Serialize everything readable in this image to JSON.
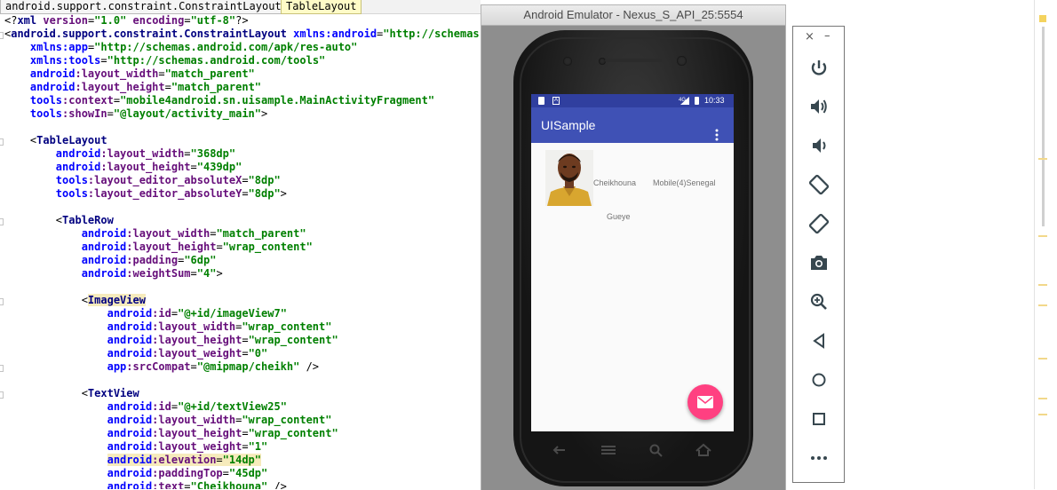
{
  "breadcrumb": [
    "android.support.constraint.ConstraintLayout",
    "TableLayout"
  ],
  "code_lines": [
    [
      [
        "t",
        "<?"
      ],
      [
        "tag",
        "xml "
      ],
      [
        "attr",
        "version"
      ],
      [
        "t",
        "="
      ],
      [
        "val",
        "\"1.0\""
      ],
      [
        "t",
        " "
      ],
      [
        "attr",
        "encoding"
      ],
      [
        "t",
        "="
      ],
      [
        "val",
        "\"utf-8\""
      ],
      [
        "t",
        "?>"
      ]
    ],
    [
      [
        "t",
        "<"
      ],
      [
        "tag",
        "android.support.constraint.ConstraintLayout "
      ],
      [
        "ns",
        "xmlns:android"
      ],
      [
        "t",
        "="
      ],
      [
        "val",
        "\"http://schemas.an"
      ]
    ],
    [
      [
        "t",
        "    "
      ],
      [
        "ns",
        "xmlns:app"
      ],
      [
        "t",
        "="
      ],
      [
        "val",
        "\"http://schemas.android.com/apk/res-auto\""
      ]
    ],
    [
      [
        "t",
        "    "
      ],
      [
        "ns",
        "xmlns:tools"
      ],
      [
        "t",
        "="
      ],
      [
        "val",
        "\"http://schemas.android.com/tools\""
      ]
    ],
    [
      [
        "t",
        "    "
      ],
      [
        "ns",
        "android"
      ],
      [
        "attr",
        ":layout_width"
      ],
      [
        "t",
        "="
      ],
      [
        "val",
        "\"match_parent\""
      ]
    ],
    [
      [
        "t",
        "    "
      ],
      [
        "ns",
        "android"
      ],
      [
        "attr",
        ":layout_height"
      ],
      [
        "t",
        "="
      ],
      [
        "val",
        "\"match_parent\""
      ]
    ],
    [
      [
        "t",
        "    "
      ],
      [
        "ns",
        "tools"
      ],
      [
        "attr",
        ":context"
      ],
      [
        "t",
        "="
      ],
      [
        "val",
        "\"mobile4android.sn.uisample.MainActivityFragment\""
      ]
    ],
    [
      [
        "t",
        "    "
      ],
      [
        "ns",
        "tools"
      ],
      [
        "attr",
        ":showIn"
      ],
      [
        "t",
        "="
      ],
      [
        "val",
        "\"@layout/activity_main\""
      ],
      [
        "t",
        ">"
      ]
    ],
    [],
    [
      [
        "t",
        "    <"
      ],
      [
        "tag",
        "TableLayout"
      ]
    ],
    [
      [
        "t",
        "        "
      ],
      [
        "ns",
        "android"
      ],
      [
        "attr",
        ":layout_width"
      ],
      [
        "t",
        "="
      ],
      [
        "val",
        "\"368dp\""
      ]
    ],
    [
      [
        "t",
        "        "
      ],
      [
        "ns",
        "android"
      ],
      [
        "attr",
        ":layout_height"
      ],
      [
        "t",
        "="
      ],
      [
        "val",
        "\"439dp\""
      ]
    ],
    [
      [
        "t",
        "        "
      ],
      [
        "ns",
        "tools"
      ],
      [
        "attr",
        ":layout_editor_absoluteX"
      ],
      [
        "t",
        "="
      ],
      [
        "val",
        "\"8dp\""
      ]
    ],
    [
      [
        "t",
        "        "
      ],
      [
        "ns",
        "tools"
      ],
      [
        "attr",
        ":layout_editor_absoluteY"
      ],
      [
        "t",
        "="
      ],
      [
        "val",
        "\"8dp\""
      ],
      [
        "t",
        ">"
      ]
    ],
    [],
    [
      [
        "t",
        "        <"
      ],
      [
        "tag",
        "TableRow"
      ]
    ],
    [
      [
        "t",
        "            "
      ],
      [
        "ns",
        "android"
      ],
      [
        "attr",
        ":layout_width"
      ],
      [
        "t",
        "="
      ],
      [
        "val",
        "\"match_parent\""
      ]
    ],
    [
      [
        "t",
        "            "
      ],
      [
        "ns",
        "android"
      ],
      [
        "attr",
        ":layout_height"
      ],
      [
        "t",
        "="
      ],
      [
        "val",
        "\"wrap_content\""
      ]
    ],
    [
      [
        "t",
        "            "
      ],
      [
        "ns",
        "android"
      ],
      [
        "attr",
        ":padding"
      ],
      [
        "t",
        "="
      ],
      [
        "val",
        "\"6dp\""
      ]
    ],
    [
      [
        "t",
        "            "
      ],
      [
        "ns",
        "android"
      ],
      [
        "attr",
        ":weightSum"
      ],
      [
        "t",
        "="
      ],
      [
        "val",
        "\"4\""
      ],
      [
        "t",
        ">"
      ]
    ],
    [],
    [
      [
        "t",
        "            <"
      ],
      [
        "tagh",
        "ImageView"
      ]
    ],
    [
      [
        "t",
        "                "
      ],
      [
        "ns",
        "android"
      ],
      [
        "attr",
        ":id"
      ],
      [
        "t",
        "="
      ],
      [
        "val",
        "\"@+id/imageView7\""
      ]
    ],
    [
      [
        "t",
        "                "
      ],
      [
        "ns",
        "android"
      ],
      [
        "attr",
        ":layout_width"
      ],
      [
        "t",
        "="
      ],
      [
        "val",
        "\"wrap_content\""
      ]
    ],
    [
      [
        "t",
        "                "
      ],
      [
        "ns",
        "android"
      ],
      [
        "attr",
        ":layout_height"
      ],
      [
        "t",
        "="
      ],
      [
        "val",
        "\"wrap_content\""
      ]
    ],
    [
      [
        "t",
        "                "
      ],
      [
        "ns",
        "android"
      ],
      [
        "attr",
        ":layout_weight"
      ],
      [
        "t",
        "="
      ],
      [
        "val",
        "\"0\""
      ]
    ],
    [
      [
        "t",
        "                "
      ],
      [
        "ns",
        "app"
      ],
      [
        "attr",
        ":srcCompat"
      ],
      [
        "t",
        "="
      ],
      [
        "val",
        "\"@mipmap/cheikh\""
      ],
      [
        "t",
        " />"
      ]
    ],
    [],
    [
      [
        "t",
        "            <"
      ],
      [
        "tag",
        "TextView"
      ]
    ],
    [
      [
        "t",
        "                "
      ],
      [
        "ns",
        "android"
      ],
      [
        "attr",
        ":id"
      ],
      [
        "t",
        "="
      ],
      [
        "val",
        "\"@+id/textView25\""
      ]
    ],
    [
      [
        "t",
        "                "
      ],
      [
        "ns",
        "android"
      ],
      [
        "attr",
        ":layout_width"
      ],
      [
        "t",
        "="
      ],
      [
        "val",
        "\"wrap_content\""
      ]
    ],
    [
      [
        "t",
        "                "
      ],
      [
        "ns",
        "android"
      ],
      [
        "attr",
        ":layout_height"
      ],
      [
        "t",
        "="
      ],
      [
        "val",
        "\"wrap_content\""
      ]
    ],
    [
      [
        "t",
        "                "
      ],
      [
        "ns",
        "android"
      ],
      [
        "attr",
        ":layout_weight"
      ],
      [
        "t",
        "="
      ],
      [
        "val",
        "\"1\""
      ]
    ],
    [
      [
        "t",
        "                "
      ],
      [
        "nsh",
        "android"
      ],
      [
        "attrh",
        ":elevation"
      ],
      [
        "th",
        "="
      ],
      [
        "valh",
        "\"14dp\""
      ]
    ],
    [
      [
        "t",
        "                "
      ],
      [
        "ns",
        "android"
      ],
      [
        "attr",
        ":paddingTop"
      ],
      [
        "t",
        "="
      ],
      [
        "val",
        "\"45dp\""
      ]
    ],
    [
      [
        "t",
        "                "
      ],
      [
        "ns",
        "android"
      ],
      [
        "attr",
        ":text"
      ],
      [
        "t",
        "="
      ],
      [
        "val",
        "\"Cheikhouna\""
      ],
      [
        "t",
        " />"
      ]
    ]
  ],
  "emulator": {
    "title": "Android Emulator - Nexus_S_API_25:5554",
    "status_time": "10:33",
    "status_network": "4G",
    "app_title": "UISample",
    "row": {
      "name_first": "Cheikhouna",
      "name_last": "Gueye",
      "company": "Mobile(4)Senegal"
    }
  },
  "toolbar": {
    "close": "×",
    "minimize": "–",
    "buttons": [
      "power-icon",
      "volume-up-icon",
      "volume-down-icon",
      "rotate-left-icon",
      "rotate-right-icon",
      "camera-icon",
      "zoom-icon",
      "back-icon",
      "home-icon",
      "overview-icon",
      "more-icon"
    ]
  },
  "colors": {
    "primary": "#3f51b5",
    "primary_dark": "#303f9f",
    "accent": "#ff4081"
  }
}
